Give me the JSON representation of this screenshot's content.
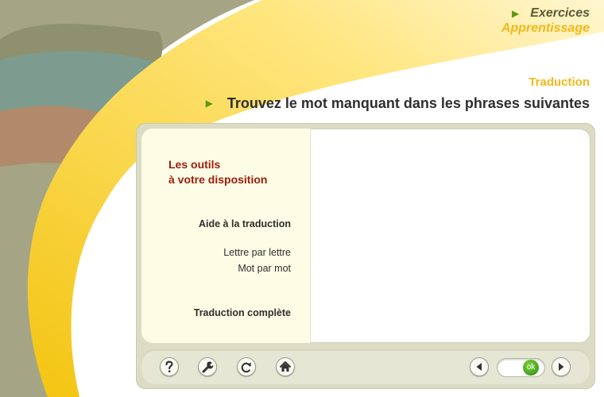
{
  "header": {
    "breadcrumb_exercices": "Exercices",
    "breadcrumb_apprentissage": "Apprentissage"
  },
  "section_title": "Traduction",
  "instruction": "Trouvez le mot manquant dans les phrases suivantes",
  "sidebar": {
    "title_line1": "Les outils",
    "title_line2": "à votre disposition",
    "aide": "Aide à la traduction",
    "lettre": "Lettre par lettre",
    "mot": "Mot par mot",
    "complete": "Traduction complète"
  },
  "toolbar": {
    "ok_label": "ok"
  },
  "icons": [
    "play-arrow-icon",
    "question-mark-icon",
    "wrench-icon",
    "redo-icon",
    "home-icon",
    "arrow-left-icon",
    "arrow-right-icon"
  ],
  "colors": {
    "accent_yellow": "#f2b81b",
    "arrow_green": "#5f9a12",
    "title_red": "#9e1b0b",
    "sidebar_bg": "#fdfde6",
    "frame_bg": "#dcdcc4",
    "ok_green": "#2b8a12"
  }
}
